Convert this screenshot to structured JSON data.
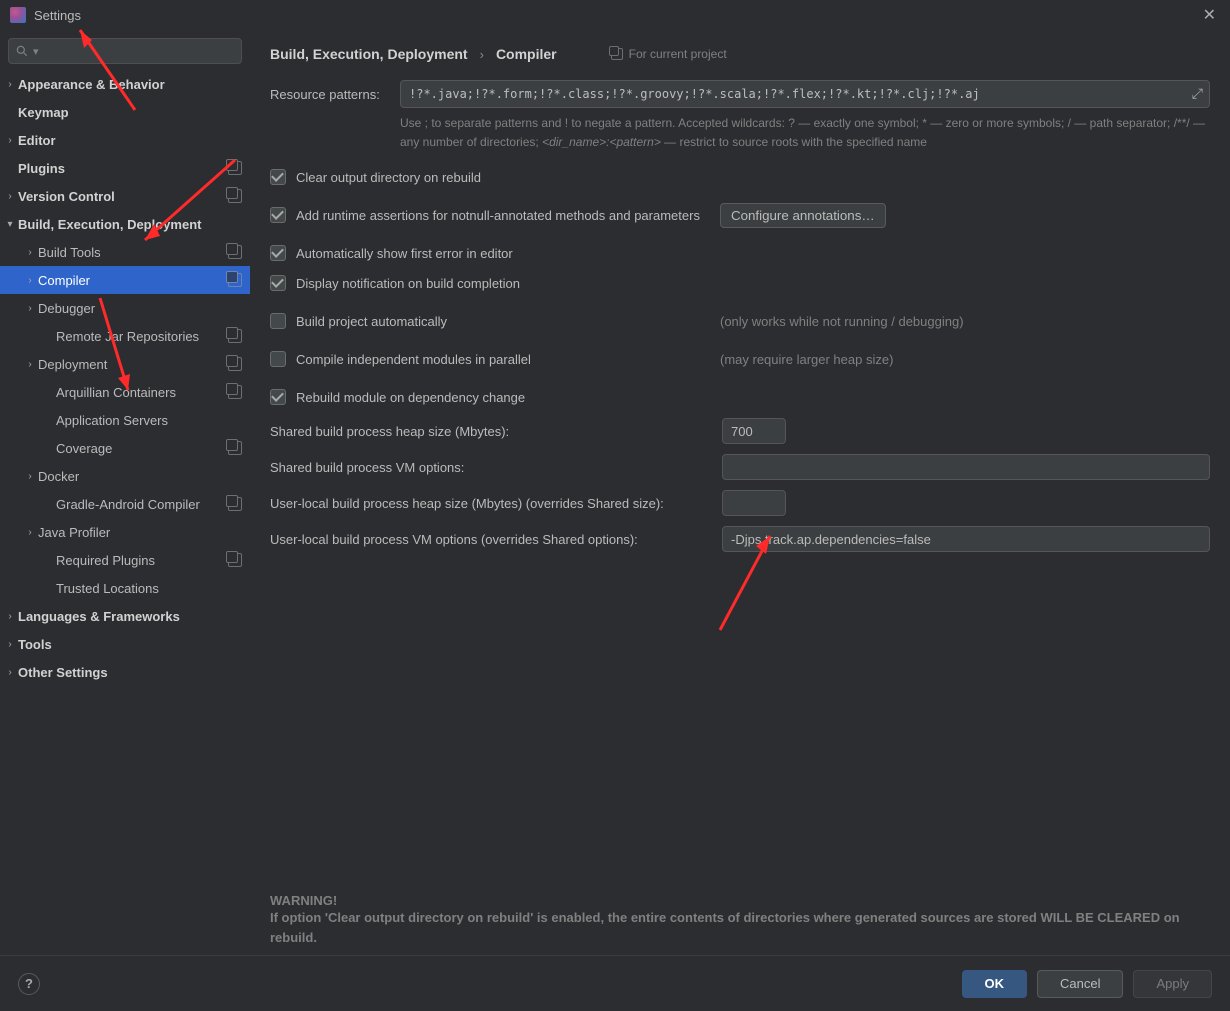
{
  "window": {
    "title": "Settings"
  },
  "sidebar": {
    "search_placeholder": "",
    "items": [
      {
        "label": "Appearance & Behavior",
        "bold": true,
        "chev": ">",
        "lvl": 0,
        "copy": false
      },
      {
        "label": "Keymap",
        "bold": true,
        "chev": "",
        "lvl": 0,
        "copy": false
      },
      {
        "label": "Editor",
        "bold": true,
        "chev": ">",
        "lvl": 0,
        "copy": false
      },
      {
        "label": "Plugins",
        "bold": true,
        "chev": "",
        "lvl": 0,
        "copy": true
      },
      {
        "label": "Version Control",
        "bold": true,
        "chev": ">",
        "lvl": 0,
        "copy": true
      },
      {
        "label": "Build, Execution, Deployment",
        "bold": true,
        "chev": "v",
        "lvl": 0,
        "copy": false
      },
      {
        "label": "Build Tools",
        "bold": false,
        "chev": ">",
        "lvl": 1,
        "copy": true
      },
      {
        "label": "Compiler",
        "bold": false,
        "chev": ">",
        "lvl": 1,
        "copy": true,
        "selected": true
      },
      {
        "label": "Debugger",
        "bold": false,
        "chev": ">",
        "lvl": 1,
        "copy": false
      },
      {
        "label": "Remote Jar Repositories",
        "bold": false,
        "chev": "",
        "lvl": 2,
        "copy": true
      },
      {
        "label": "Deployment",
        "bold": false,
        "chev": ">",
        "lvl": 1,
        "copy": true
      },
      {
        "label": "Arquillian Containers",
        "bold": false,
        "chev": "",
        "lvl": 2,
        "copy": true
      },
      {
        "label": "Application Servers",
        "bold": false,
        "chev": "",
        "lvl": 2,
        "copy": false
      },
      {
        "label": "Coverage",
        "bold": false,
        "chev": "",
        "lvl": 2,
        "copy": true
      },
      {
        "label": "Docker",
        "bold": false,
        "chev": ">",
        "lvl": 1,
        "copy": false
      },
      {
        "label": "Gradle-Android Compiler",
        "bold": false,
        "chev": "",
        "lvl": 2,
        "copy": true
      },
      {
        "label": "Java Profiler",
        "bold": false,
        "chev": ">",
        "lvl": 1,
        "copy": false
      },
      {
        "label": "Required Plugins",
        "bold": false,
        "chev": "",
        "lvl": 2,
        "copy": true
      },
      {
        "label": "Trusted Locations",
        "bold": false,
        "chev": "",
        "lvl": 2,
        "copy": false
      },
      {
        "label": "Languages & Frameworks",
        "bold": true,
        "chev": ">",
        "lvl": 0,
        "copy": false
      },
      {
        "label": "Tools",
        "bold": true,
        "chev": ">",
        "lvl": 0,
        "copy": false
      },
      {
        "label": "Other Settings",
        "bold": true,
        "chev": ">",
        "lvl": 0,
        "copy": false
      }
    ]
  },
  "breadcrumb": {
    "a": "Build, Execution, Deployment",
    "sep": "›",
    "b": "Compiler",
    "hint": "For current project"
  },
  "resource": {
    "label": "Resource patterns:",
    "value": "!?*.java;!?*.form;!?*.class;!?*.groovy;!?*.scala;!?*.flex;!?*.kt;!?*.clj;!?*.aj",
    "hint_a": "Use ; to separate patterns and ! to negate a pattern. Accepted wildcards: ? — exactly one symbol; * — zero or more symbols; / — path separator; /**/ — any number of directories; ",
    "hint_b": "<dir_name>:<pattern>",
    "hint_c": " — restrict to source roots with the specified name"
  },
  "checks": {
    "clear": "Clear output directory on rebuild",
    "assert": "Add runtime assertions for notnull-annotated methods and parameters",
    "configure": "Configure annotations…",
    "autoerr": "Automatically show first error in editor",
    "notify": "Display notification on build completion",
    "auto": "Build project automatically",
    "auto_note": "(only works while not running / debugging)",
    "parallel": "Compile independent modules in parallel",
    "parallel_note": "(may require larger heap size)",
    "rebuild": "Rebuild module on dependency change"
  },
  "fields": {
    "shared_heap_label": "Shared build process heap size (Mbytes):",
    "shared_heap_value": "700",
    "shared_vm_label": "Shared build process VM options:",
    "shared_vm_value": "",
    "user_heap_label": "User-local build process heap size (Mbytes) (overrides Shared size):",
    "user_heap_value": "",
    "user_vm_label": "User-local build process VM options (overrides Shared options):",
    "user_vm_value": "-Djps.track.ap.dependencies=false"
  },
  "warning": {
    "title": "WARNING!",
    "text": "If option 'Clear output directory on rebuild' is enabled, the entire contents of directories where generated sources are stored WILL BE CLEARED on rebuild."
  },
  "footer": {
    "ok": "OK",
    "cancel": "Cancel",
    "apply": "Apply"
  }
}
